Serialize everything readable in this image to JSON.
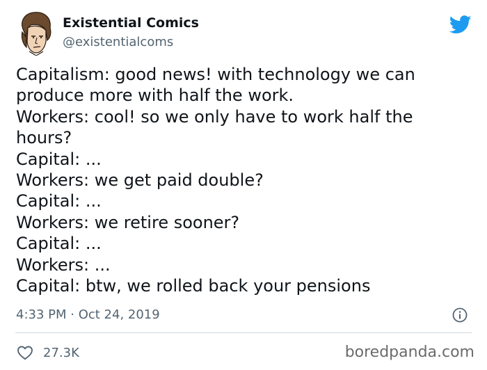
{
  "author": {
    "name": "Existential Comics",
    "handle": "@existentialcoms",
    "avatar_icon": "philosopher-portrait-avatar"
  },
  "tweet": {
    "lines": [
      "Capitalism: good news! with technology we can",
      "produce more with half the work.",
      "Workers: cool! so we only have to work half the",
      "hours?",
      "Capital: ...",
      "Workers: we get paid double?",
      "Capital: ...",
      "Workers: we retire sooner?",
      "Capital: ...",
      "Workers: ...",
      "Capital: btw, we rolled back your pensions"
    ],
    "timestamp": "4:33 PM · Oct 24, 2019",
    "likes": "27.3K"
  },
  "icons": {
    "brand": "twitter-bird-icon",
    "info": "info-icon",
    "like": "heart-icon"
  },
  "colors": {
    "brand": "#1d9bf0",
    "text": "#0f1419",
    "muted": "#536471",
    "divider": "#cfd9de"
  },
  "watermark": "boredpanda.com"
}
